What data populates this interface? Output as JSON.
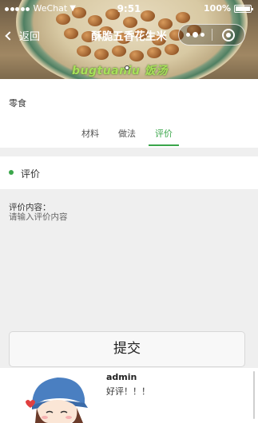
{
  "status_bar": {
    "carrier": "WeChat",
    "time": "9:51",
    "battery": "100%"
  },
  "navbar": {
    "back_label": "返回",
    "title": "酥脆五香花生米"
  },
  "hero": {
    "watermark": "bugtuaniu 饭汤"
  },
  "recipe": {
    "category": "零食"
  },
  "tabs": [
    {
      "label": "材料"
    },
    {
      "label": "做法"
    },
    {
      "label": "评价"
    }
  ],
  "active_tab": "评价",
  "section": {
    "title": "评价"
  },
  "review_form": {
    "label": "评价内容：",
    "placeholder": "请输入评价内容",
    "value": "",
    "submit_label": "提交"
  },
  "comments": [
    {
      "user": "admin",
      "text": "好评！！！"
    }
  ],
  "colors": {
    "accent": "#3aa64a",
    "page_background": "#efefef"
  }
}
